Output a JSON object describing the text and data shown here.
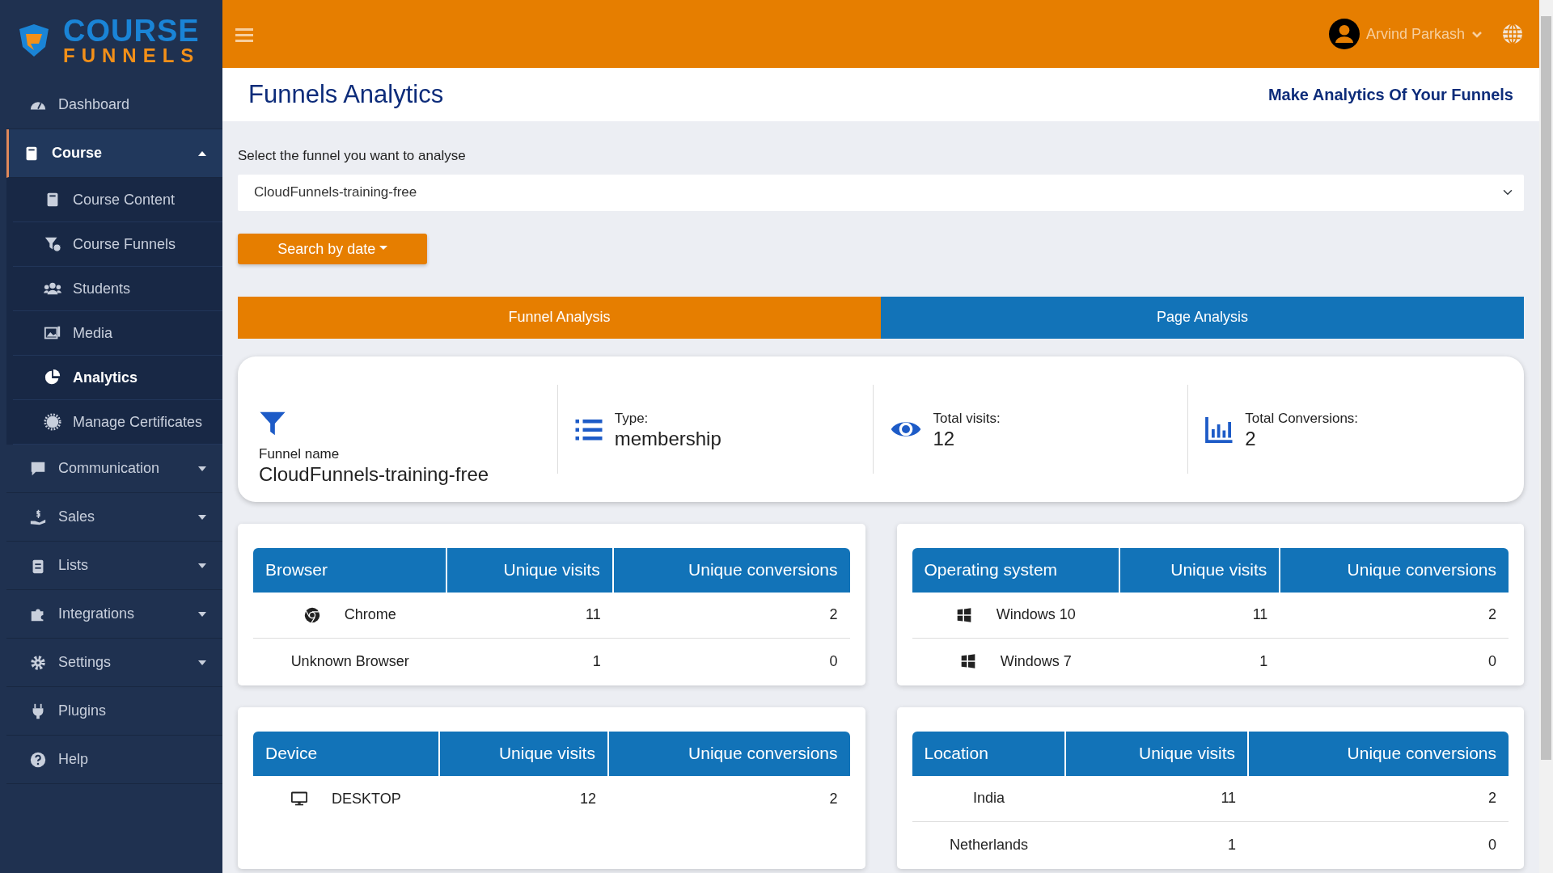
{
  "logo": {
    "line_1": "COURSE",
    "line_2": "FUNNELS"
  },
  "sidebar": {
    "items": [
      {
        "label": "Dashboard",
        "selected": false
      },
      {
        "label": "Course",
        "selected": true,
        "expanded": true,
        "children": [
          {
            "label": "Course Content",
            "selected": false
          },
          {
            "label": "Course Funnels",
            "selected": false
          },
          {
            "label": "Students",
            "selected": false
          },
          {
            "label": "Media",
            "selected": false
          },
          {
            "label": "Analytics",
            "selected": true
          },
          {
            "label": "Manage Certificates",
            "selected": false
          }
        ]
      },
      {
        "label": "Communication",
        "selected": false,
        "expanded": false
      },
      {
        "label": "Sales",
        "selected": false,
        "expanded": false
      },
      {
        "label": "Lists",
        "selected": false,
        "expanded": false
      },
      {
        "label": "Integrations",
        "selected": false,
        "expanded": false
      },
      {
        "label": "Settings",
        "selected": false,
        "expanded": false
      },
      {
        "label": "Plugins",
        "selected": false
      },
      {
        "label": "Help",
        "selected": false
      }
    ]
  },
  "topbar": {
    "user_name": "Arvind Parkash"
  },
  "page_header": {
    "title": "Funnels Analytics",
    "subtitle": "Make Analytics Of Your Funnels"
  },
  "funnel_select": {
    "label": "Select the funnel you want to analyse",
    "value": "CloudFunnels-training-free"
  },
  "date_button": "Search by date",
  "tabs": [
    {
      "label": "Funnel Analysis",
      "selected": true
    },
    {
      "label": "Page Analysis",
      "selected": false
    }
  ],
  "summary": [
    {
      "label": "Funnel name",
      "value": "CloudFunnels-training-free"
    },
    {
      "label": "Type:",
      "value": "membership"
    },
    {
      "label": "Total visits:",
      "value": "12"
    },
    {
      "label": "Total Conversions:",
      "value": "2"
    }
  ],
  "tables": [
    {
      "columns": [
        "Browser",
        "Unique visits",
        "Unique conversions"
      ],
      "rows": [
        {
          "kind": "chrome",
          "cells": [
            "Chrome",
            "11",
            "2"
          ]
        },
        {
          "kind": "plain",
          "cells": [
            "Unknown Browser",
            "1",
            "0"
          ]
        }
      ]
    },
    {
      "columns": [
        "Operating system",
        "Unique visits",
        "Unique conversions"
      ],
      "rows": [
        {
          "kind": "windows",
          "cells": [
            "Windows 10",
            "11",
            "2"
          ]
        },
        {
          "kind": "windows",
          "cells": [
            "Windows 7",
            "1",
            "0"
          ]
        }
      ]
    },
    {
      "columns": [
        "Device",
        "Unique visits",
        "Unique conversions"
      ],
      "rows": [
        {
          "kind": "desktop",
          "cells": [
            "DESKTOP",
            "12",
            "2"
          ]
        }
      ]
    },
    {
      "columns": [
        "Location",
        "Unique visits",
        "Unique conversions"
      ],
      "rows": [
        {
          "kind": "plain",
          "cells": [
            "India",
            "11",
            "2"
          ]
        },
        {
          "kind": "plain",
          "cells": [
            "Netherlands",
            "1",
            "0"
          ]
        }
      ]
    }
  ]
}
